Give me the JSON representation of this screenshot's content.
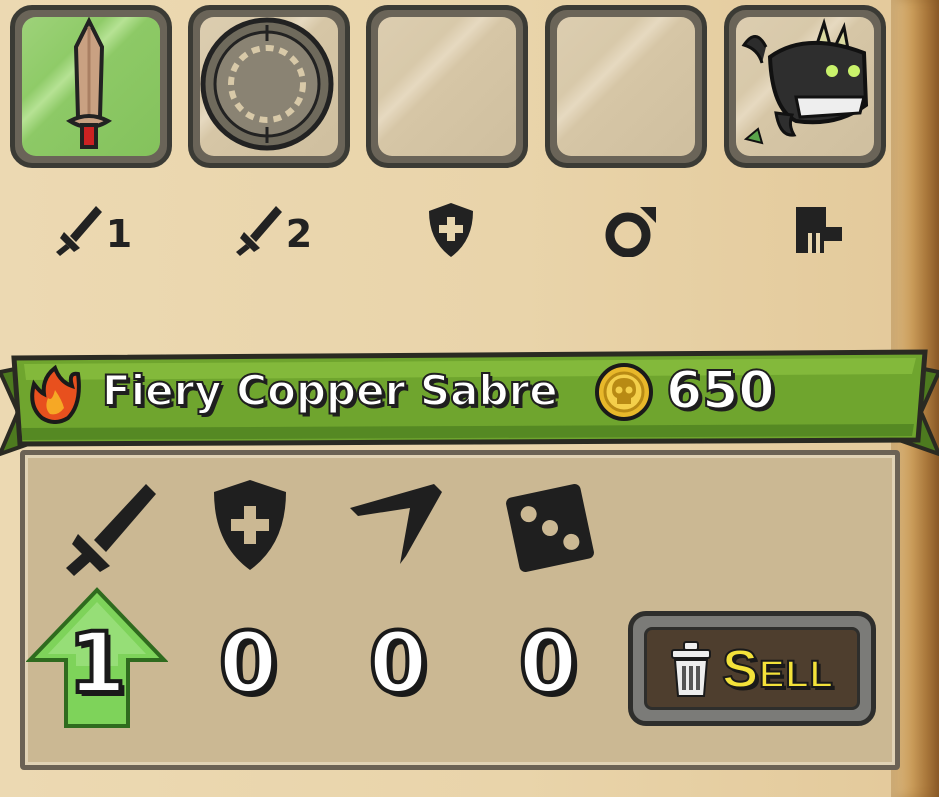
{
  "equipment_slots": [
    {
      "key": "weapon1",
      "selected": true,
      "item": "sword-icon",
      "slot_icon": "sword-icon",
      "slot_number": "1"
    },
    {
      "key": "weapon2",
      "selected": false,
      "item": "round-shield-icon",
      "slot_icon": "sword-icon",
      "slot_number": "2"
    },
    {
      "key": "armor",
      "selected": false,
      "item": null,
      "slot_icon": "shield-plus-icon",
      "slot_number": ""
    },
    {
      "key": "ring",
      "selected": false,
      "item": null,
      "slot_icon": "ring-icon",
      "slot_number": ""
    },
    {
      "key": "pet",
      "selected": false,
      "item": "black-dragon-pet-icon",
      "slot_icon": "boot-icon",
      "slot_number": ""
    }
  ],
  "item": {
    "name": "Fiery Copper Sabre",
    "element_icon": "fire-icon",
    "price_icon": "skull-coin-icon",
    "price": "650"
  },
  "stats": [
    {
      "icon": "sword-icon",
      "value": "1",
      "upgrade": true
    },
    {
      "icon": "shield-plus-icon",
      "value": "0",
      "upgrade": false
    },
    {
      "icon": "boomerang-icon",
      "value": "0",
      "upgrade": false
    },
    {
      "icon": "dice-icon",
      "value": "0",
      "upgrade": false
    }
  ],
  "sell_button": {
    "label": "Sell",
    "icon": "trash-can-icon"
  },
  "colors": {
    "selected_slot": "#8fcb68",
    "banner_green": "#6fa52e",
    "upgrade_arrow": "#7ed35a",
    "sell_text": "#f3e23a",
    "coin_gold": "#e8b82a"
  }
}
